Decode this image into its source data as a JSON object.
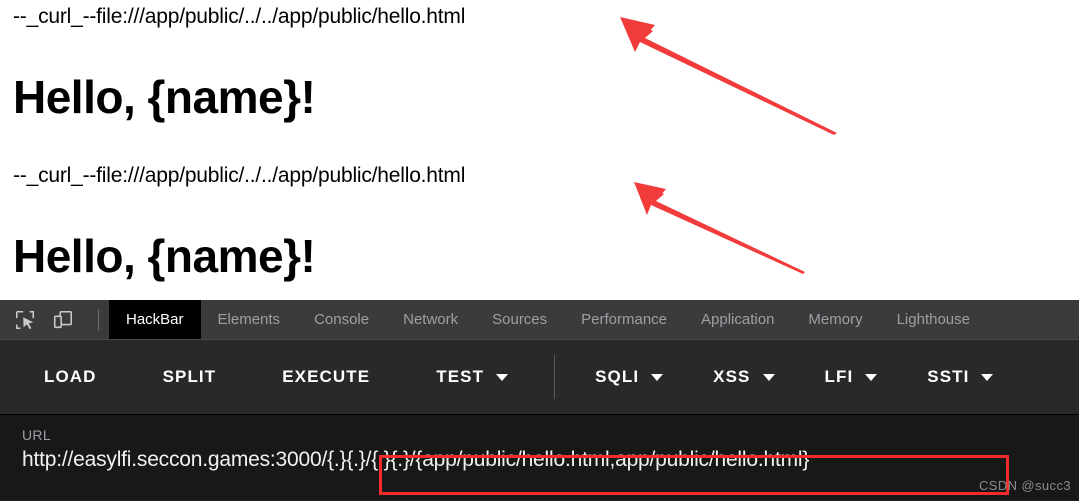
{
  "page_response": {
    "blocks": [
      {
        "command": "--_curl_--file:///app/public/../../app/public/hello.html",
        "heading": "Hello, {name}!"
      },
      {
        "command": "--_curl_--file:///app/public/../../app/public/hello.html",
        "heading": "Hello, {name}!"
      }
    ]
  },
  "annotations": {
    "arrow_color": "#f23b3b",
    "arrows": [
      {
        "name": "arrow-to-first-response"
      },
      {
        "name": "arrow-to-second-response"
      }
    ]
  },
  "devtools": {
    "icons": [
      {
        "name": "inspect-element-icon"
      },
      {
        "name": "device-toolbar-icon"
      }
    ],
    "tabs": [
      {
        "label": "HackBar",
        "active": true
      },
      {
        "label": "Elements",
        "active": false
      },
      {
        "label": "Console",
        "active": false
      },
      {
        "label": "Network",
        "active": false
      },
      {
        "label": "Sources",
        "active": false
      },
      {
        "label": "Performance",
        "active": false
      },
      {
        "label": "Application",
        "active": false
      },
      {
        "label": "Memory",
        "active": false
      },
      {
        "label": "Lighthouse",
        "active": false
      }
    ],
    "active_tab_bg": "#000000",
    "tabbar_bg": "#3b3b3b"
  },
  "hackbar": {
    "actions": [
      {
        "label": "LOAD",
        "has_caret": false
      },
      {
        "label": "SPLIT",
        "has_caret": false
      },
      {
        "label": "EXECUTE",
        "has_caret": false
      },
      {
        "label": "TEST",
        "has_caret": true
      }
    ],
    "payload_menus": [
      {
        "label": "SQLI",
        "has_caret": true
      },
      {
        "label": "XSS",
        "has_caret": true
      },
      {
        "label": "LFI",
        "has_caret": true
      },
      {
        "label": "SSTI",
        "has_caret": true
      }
    ],
    "url_label": "URL",
    "url_value": "http://easylfi.seccon.games:3000/{.}{.}/{.}{.}/{app/public/hello.html,app/public/hello.html}",
    "highlight_color": "#f22b2b"
  },
  "watermark": "CSDN @succ3"
}
